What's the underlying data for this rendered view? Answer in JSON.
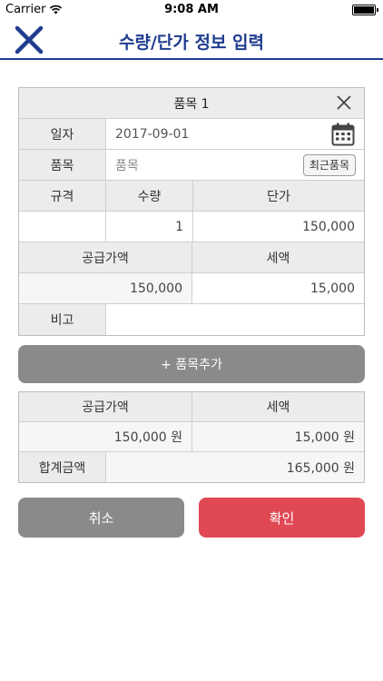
{
  "status_bar": {
    "carrier": "Carrier",
    "time": "9:08 AM"
  },
  "nav": {
    "title": "수량/단가 정보 입력"
  },
  "item": {
    "title": "품목 1",
    "date_label": "일자",
    "date_value": "2017-09-01",
    "product_label": "품목",
    "product_placeholder": "품목",
    "recent_button": "최근품목",
    "spec_label": "규격",
    "qty_label": "수량",
    "price_label": "단가",
    "spec_value": "",
    "qty_value": "1",
    "price_value": "150,000",
    "supply_label": "공급가액",
    "tax_label": "세액",
    "supply_value": "150,000",
    "tax_value": "15,000",
    "note_label": "비고",
    "note_value": ""
  },
  "add_button": "+ 품목추가",
  "summary": {
    "supply_label": "공급가액",
    "tax_label": "세액",
    "supply_value": "150,000 원",
    "tax_value": "15,000 원",
    "total_label": "합계금액",
    "total_value": "165,000 원"
  },
  "actions": {
    "cancel": "취소",
    "confirm": "확인"
  },
  "colors": {
    "accent": "#1f3c8e",
    "confirm": "#e04854",
    "neutral_button": "#8a8a8a"
  }
}
